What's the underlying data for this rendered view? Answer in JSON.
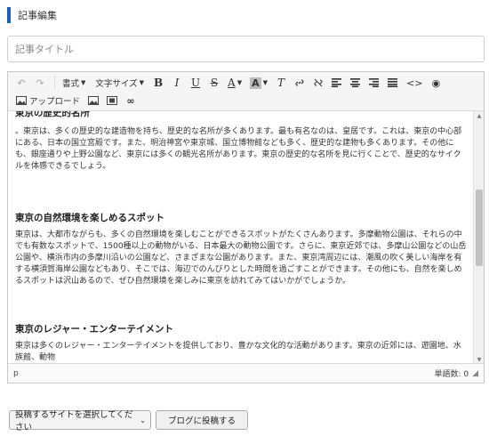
{
  "header": {
    "title": "記事編集",
    "accent_color": "#1a5fb4"
  },
  "title_input": {
    "placeholder": "記事タイトル",
    "value": ""
  },
  "toolbar": {
    "undo_icon": "undo-icon",
    "redo_icon": "redo-icon",
    "format_label": "書式",
    "font_size_label": "文字サイズ",
    "bold": "B",
    "italic": "I",
    "underline": "U",
    "strike": "S",
    "text_color": "A",
    "bg_color": "A",
    "clear_format": "T",
    "upload_label": "アップロード"
  },
  "content": {
    "section1_heading_partial": "東京の歴史的名所",
    "section1_body": "。東京は、多くの歴史的な建造物を持ち、歴史的な名所が多くあります。最も有名なのは、皇居です。これは、東京の中心部にある、日本の国立宮殿です。また、明治神宮や東京城、国立博物館なども多く、歴史的な建物も多くあります。その他にも、銀座通りや上野公園など、東京には多くの観光名所があります。東京の歴史的な名所を見に行くことで、歴史的なサイクルを体感できるでしょう。",
    "section2_heading": "東京の自然環境を楽しめるスポット",
    "section2_body": "東京は、大都市ながらも、多くの自然環境を楽しむことができるスポットがたくさんあります。多摩動物公園は、それらの中でも有数なスポットで、1500種以上の動物がいる、日本最大の動物公園です。さらに、東京近郊では、多摩山公園などの山岳公園や、横浜市内の多摩川沿いの公園など、さまざまな公園があります。また、東京湾周辺には、潮風の吹く美しい海岸を有する横須賀海岸公園などもあり、そこでは、海辺でのんびりとした時間を過ごすことができます。その他にも、自然を楽しめるスポットは沢山あるので、ぜひ自然環境を楽しみに東京を訪れてみてはいかがでしょうか。",
    "section3_heading": "東京のレジャー・エンターテイメント",
    "section3_body": "東京は多くのレジャー・エンターテイメントを提供しており、豊かな文化的な活動があります。東京の近郊には、遊園地、水族館、動物"
  },
  "status": {
    "element_path": "p",
    "word_count_label": "単語数: 0"
  },
  "footer": {
    "site_select_label": "投稿するサイトを選択してください",
    "post_button_label": "ブログに投稿する"
  }
}
